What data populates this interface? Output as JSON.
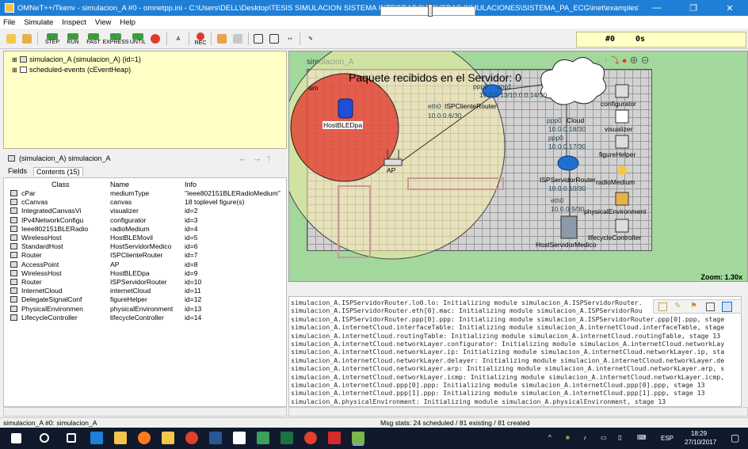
{
  "window": {
    "title": "OMNeT++/Tkenv - simulacion_A #0 - omnetpp.ini - C:\\Users\\DELL\\Desktop\\TESIS SIMULACION SISTEMA INTEGRADO\\PRUEBAS SIMULACIONES\\SISTEMA_PA_ECG\\inet\\examples\\sistema_pa_ecg\\escenario1"
  },
  "menu": [
    "File",
    "Simulate",
    "Inspect",
    "View",
    "Help"
  ],
  "toolbar": {
    "step": "STEP",
    "run": "RUN",
    "fast": "FAST",
    "express": "EXPRESS",
    "until": "UNTIL",
    "stop": "STOP",
    "rec": "REC",
    "event_num": "#0",
    "sim_time": "0s"
  },
  "tree": [
    {
      "expander": "⊞",
      "label": "simulacion_A (simulacion_A) (id=1)"
    },
    {
      "expander": "⊞",
      "label": "scheduled-events (cEventHeap)"
    }
  ],
  "inspector": {
    "title": "(simulacion_A) simulacion_A",
    "tabs": [
      "Fields",
      "Contents (15)"
    ],
    "columns": [
      "Class",
      "Name",
      "Info"
    ],
    "rows": [
      {
        "cls": "cPar",
        "name": "mediumType",
        "info": "\"Ieee802151BLERadioMedium\""
      },
      {
        "cls": "cCanvas",
        "name": "canvas",
        "info": "18 toplevel figure(s)"
      },
      {
        "cls": "IntegratedCanvasVi",
        "name": "visualizer",
        "info": "id=2"
      },
      {
        "cls": "IPv4NetworkConfigu",
        "name": "configurator",
        "info": "id=3"
      },
      {
        "cls": "Ieee802151BLERadio",
        "name": "radioMedium",
        "info": "id=4"
      },
      {
        "cls": "WirelessHost",
        "name": "HostBLEMovil",
        "info": "id=5"
      },
      {
        "cls": "StandardHost",
        "name": "HostServidorMedico",
        "info": "id=6"
      },
      {
        "cls": "Router",
        "name": "ISPClienteRouter",
        "info": "id=7"
      },
      {
        "cls": "AccessPoint",
        "name": "AP",
        "info": "id=8"
      },
      {
        "cls": "WirelessHost",
        "name": "HostBLEDpa",
        "info": "id=9"
      },
      {
        "cls": "Router",
        "name": "ISPServidorRouter",
        "info": "id=10"
      },
      {
        "cls": "InternetCloud",
        "name": "internetCloud",
        "info": "id=11"
      },
      {
        "cls": "DelegateSignalConf",
        "name": "figureHelper",
        "info": "id=12"
      },
      {
        "cls": "PhysicalEnvironmen",
        "name": "physicalEnvironment",
        "info": "id=13"
      },
      {
        "cls": "LifecycleController",
        "name": "lifecycleController",
        "info": "id=14"
      }
    ]
  },
  "network": {
    "title": "simulacion_A",
    "banner": "Paquete recibidos en el Servidor: 0",
    "zoom": "Zoom: 1.30x",
    "labels": {
      "host_ble_dpa": "HostBLEDpa",
      "ap": "AP",
      "isp_cliente": "ISPClienteRouter",
      "isp_cliente_eth": "eth0",
      "isp_cliente_ip": "10.0.0.6/30",
      "ppp0": "ppp0",
      "ppp1": "ppp1",
      "ppp_ips": "10.0.0.13/10.0.0.14/30",
      "cloud_ppp0": "ppp0",
      "cloud_label": "Cloud",
      "cloud_ip1": "10.0.0.18/30",
      "cloud_ppp0b": "ppp0",
      "cloud_ip2": "10.0.0.17/30",
      "isp_servidor": "ISPServidorRouter",
      "isp_servidor_ip": "10.0.0.10/30",
      "eth0b": "eth0",
      "eth0b_ip": "10.0.0.9/30",
      "servidor": "HostServidorMedico",
      "configurator": "configurator",
      "visualizer": "visualizer",
      "figure_helper": "figureHelper",
      "radio_medium": "radioMedium",
      "physical_environment": "physicalEnvironment",
      "lifecycle": "lifecycleController",
      "ble_prefix": "sim"
    }
  },
  "log": [
    "simulacion_A.ISPServidorRouter.lo0.lo: Initializing module simulacion_A.ISPServidorRouter.",
    "simulacion_A.ISPServidorRouter.eth[0].mac: Initializing module simulacion_A.ISPServidorRou",
    "simulacion_A.ISPServidorRouter.ppp[0].ppp: Initializing module simulacion_A.ISPServidorRouter.ppp[0].ppp, stage",
    "simulacion_A.internetCloud.interfaceTable: Initializing module simulacion_A.internetCloud.interfaceTable, stage",
    "simulacion_A.internetCloud.routingTable: Initializing module simulacion_A.internetCloud.routingTable, stage 13",
    "simulacion_A.internetCloud.networkLayer.configurator: Initializing module simulacion_A.internetCloud.networkLay",
    "simulacion_A.internetCloud.networkLayer.ip: Initializing module simulacion_A.internetCloud.networkLayer.ip, sta",
    "simulacion_A.internetCloud.networkLayer.delayer: Initializing module simulacion_A.internetCloud.networkLayer.de",
    "simulacion_A.internetCloud.networkLayer.arp: Initializing module simulacion_A.internetCloud.networkLayer.arp, s",
    "simulacion_A.internetCloud.networkLayer.icmp: Initializing module simulacion_A.internetCloud.networkLayer.icmp,",
    "simulacion_A.internetCloud.ppp[0].ppp: Initializing module simulacion_A.internetCloud.ppp[0].ppp, stage 13",
    "simulacion_A.internetCloud.ppp[1].ppp: Initializing module simulacion_A.internetCloud.ppp[1].ppp, stage 13",
    "simulacion_A.physicalEnvironment: Initializing module simulacion_A.physicalEnvironment, stage 13"
  ],
  "status": {
    "left": "simulacion_A #0: simulacion_A",
    "right": "Msg stats: 24 scheduled / 81 existing / 81 created"
  },
  "taskbar": {
    "lang": "ESP",
    "time": "18:29",
    "date": "27/10/2017"
  }
}
